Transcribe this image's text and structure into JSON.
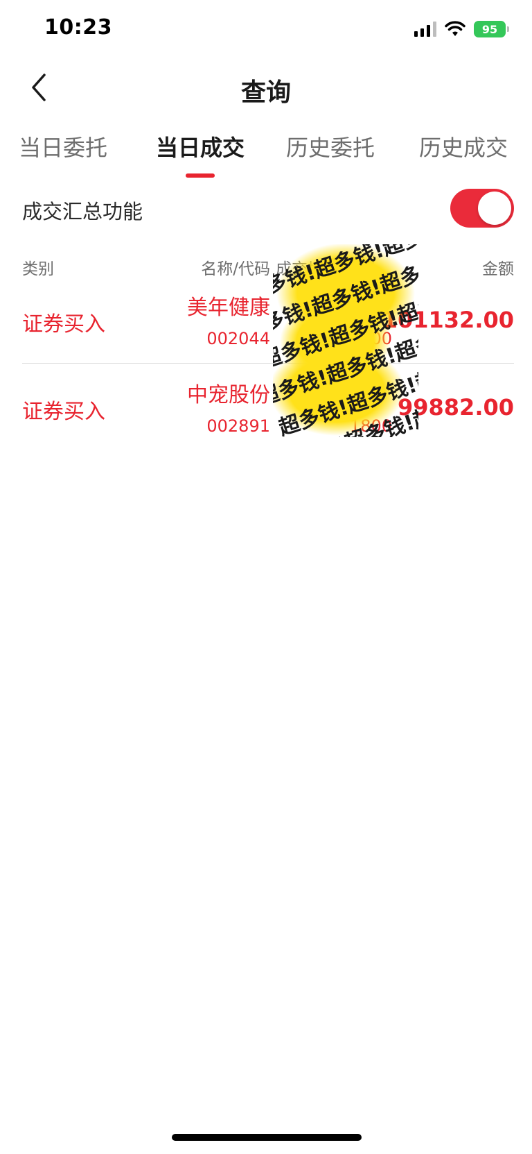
{
  "status_bar": {
    "time": "10:23",
    "battery": "95"
  },
  "nav": {
    "title": "查询"
  },
  "tabs": [
    {
      "label": "当日委托",
      "active": false
    },
    {
      "label": "当日成交",
      "active": true
    },
    {
      "label": "历史委托",
      "active": false
    },
    {
      "label": "历史成交",
      "active": false
    }
  ],
  "summary": {
    "label": "成交汇总功能",
    "enabled": true
  },
  "table": {
    "headers": {
      "type": "类别",
      "name_code": "名称/代码",
      "price_qty": "成交均价/数量",
      "amount": "金额"
    },
    "rows": [
      {
        "type": "证券买入",
        "name": "美年健康",
        "code": "002044",
        "qty": "00",
        "amount": "101132.00"
      },
      {
        "type": "证券买入",
        "name": "中宠股份",
        "code": "002891",
        "qty": "1800",
        "amount": "99882.00"
      }
    ]
  },
  "sticker": {
    "text": "超多钱!超多钱!超多钱!"
  },
  "colors": {
    "accent_red": "#e8242f",
    "battery_green": "#34c759",
    "sticker_yellow": "#ffe11a"
  }
}
